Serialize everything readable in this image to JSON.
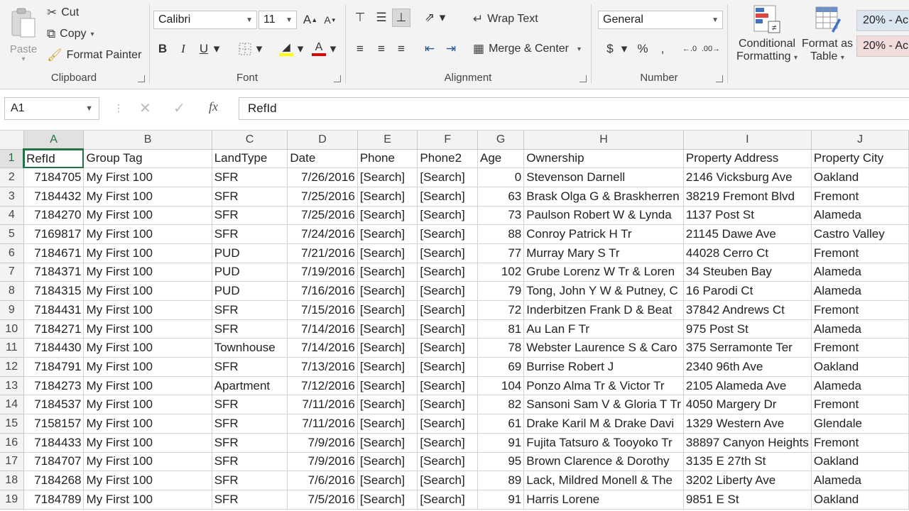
{
  "ribbon": {
    "clipboard": {
      "paste": "Paste",
      "cut": "Cut",
      "copy": "Copy",
      "format_painter": "Format Painter",
      "label": "Clipboard"
    },
    "font": {
      "name": "Calibri",
      "size": "11",
      "bold": "B",
      "italic": "I",
      "underline": "U",
      "label": "Font"
    },
    "alignment": {
      "wrap_text": "Wrap Text",
      "merge_center": "Merge & Center",
      "label": "Alignment"
    },
    "number": {
      "format": "General",
      "currency": "$",
      "percent": "%",
      "comma": "‚",
      "label": "Number"
    },
    "styles": {
      "conditional_line1": "Conditional",
      "conditional_line2": "Formatting",
      "table_line1": "Format as",
      "table_line2": "Table",
      "style1": "20% - Ac",
      "style2": "20% - Ac"
    }
  },
  "formula_bar": {
    "name_box": "A1",
    "fx": "fx",
    "content": "RefId"
  },
  "colors": {
    "accent": "#217346",
    "style1_bg": "#dce6f1",
    "style2_bg": "#f2dcdb"
  },
  "grid": {
    "columns": [
      "A",
      "B",
      "C",
      "D",
      "E",
      "F",
      "G",
      "H",
      "I",
      "J"
    ],
    "rows": [
      [
        "1",
        "RefId",
        "Group Tag",
        "LandType",
        "Date",
        "Phone",
        "Phone2",
        "Age",
        "Ownership",
        "Property Address",
        "Property City"
      ],
      [
        "2",
        "7184705",
        "My First 100",
        "SFR",
        "7/26/2016",
        "[Search]",
        "[Search]",
        "0",
        "Stevenson Darnell",
        "2146 Vicksburg Ave",
        "Oakland"
      ],
      [
        "3",
        "7184432",
        "My First 100",
        "SFR",
        "7/25/2016",
        "[Search]",
        "[Search]",
        "63",
        "Brask Olga G & Braskherren",
        "38219 Fremont Blvd",
        "Fremont"
      ],
      [
        "4",
        "7184270",
        "My First 100",
        "SFR",
        "7/25/2016",
        "[Search]",
        "[Search]",
        "73",
        "Paulson Robert W & Lynda",
        "1137 Post St",
        "Alameda"
      ],
      [
        "5",
        "7169817",
        "My First 100",
        "SFR",
        "7/24/2016",
        "[Search]",
        "[Search]",
        "88",
        "Conroy Patrick H Tr",
        "21145 Dawe Ave",
        "Castro Valley"
      ],
      [
        "6",
        "7184671",
        "My First 100",
        "PUD",
        "7/21/2016",
        "[Search]",
        "[Search]",
        "77",
        "Murray Mary S Tr",
        "44028 Cerro Ct",
        "Fremont"
      ],
      [
        "7",
        "7184371",
        "My First 100",
        "PUD",
        "7/19/2016",
        "[Search]",
        "[Search]",
        "102",
        "Grube Lorenz W Tr & Loren",
        "34 Steuben Bay",
        "Alameda"
      ],
      [
        "8",
        "7184315",
        "My First 100",
        "PUD",
        "7/16/2016",
        "[Search]",
        "[Search]",
        "79",
        "Tong, John Y W & Putney, C",
        "16 Parodi Ct",
        "Alameda"
      ],
      [
        "9",
        "7184431",
        "My First 100",
        "SFR",
        "7/15/2016",
        "[Search]",
        "[Search]",
        "72",
        "Inderbitzen Frank D & Beat",
        "37842 Andrews Ct",
        "Fremont"
      ],
      [
        "10",
        "7184271",
        "My First 100",
        "SFR",
        "7/14/2016",
        "[Search]",
        "[Search]",
        "81",
        "Au Lan F Tr",
        "975 Post St",
        "Alameda"
      ],
      [
        "11",
        "7184430",
        "My First 100",
        "Townhouse",
        "7/14/2016",
        "[Search]",
        "[Search]",
        "78",
        "Webster Laurence S & Caro",
        "375 Serramonte Ter",
        "Fremont"
      ],
      [
        "12",
        "7184791",
        "My First 100",
        "SFR",
        "7/13/2016",
        "[Search]",
        "[Search]",
        "69",
        "Burrise Robert J",
        "2340 96th Ave",
        "Oakland"
      ],
      [
        "13",
        "7184273",
        "My First 100",
        "Apartment",
        "7/12/2016",
        "[Search]",
        "[Search]",
        "104",
        "Ponzo Alma Tr & Victor Tr",
        "2105 Alameda Ave",
        "Alameda"
      ],
      [
        "14",
        "7184537",
        "My First 100",
        "SFR",
        "7/11/2016",
        "[Search]",
        "[Search]",
        "82",
        "Sansoni Sam V & Gloria T Tr",
        "4050 Margery Dr",
        "Fremont"
      ],
      [
        "15",
        "7158157",
        "My First 100",
        "SFR",
        "7/11/2016",
        "[Search]",
        "[Search]",
        "61",
        "Drake Karil M & Drake Davi",
        "1329 Western Ave",
        "Glendale"
      ],
      [
        "16",
        "7184433",
        "My First 100",
        "SFR",
        "7/9/2016",
        "[Search]",
        "[Search]",
        "91",
        "Fujita Tatsuro & Tooyoko Tr",
        "38897 Canyon Heights",
        "Fremont"
      ],
      [
        "17",
        "7184707",
        "My First 100",
        "SFR",
        "7/9/2016",
        "[Search]",
        "[Search]",
        "95",
        "Brown Clarence & Dorothy",
        "3135 E 27th St",
        "Oakland"
      ],
      [
        "18",
        "7184268",
        "My First 100",
        "SFR",
        "7/6/2016",
        "[Search]",
        "[Search]",
        "89",
        "Lack, Mildred Monell & The",
        "3202 Liberty Ave",
        "Alameda"
      ],
      [
        "19",
        "7184789",
        "My First 100",
        "SFR",
        "7/5/2016",
        "[Search]",
        "[Search]",
        "91",
        "Harris Lorene",
        "9851 E St",
        "Oakland"
      ]
    ]
  }
}
